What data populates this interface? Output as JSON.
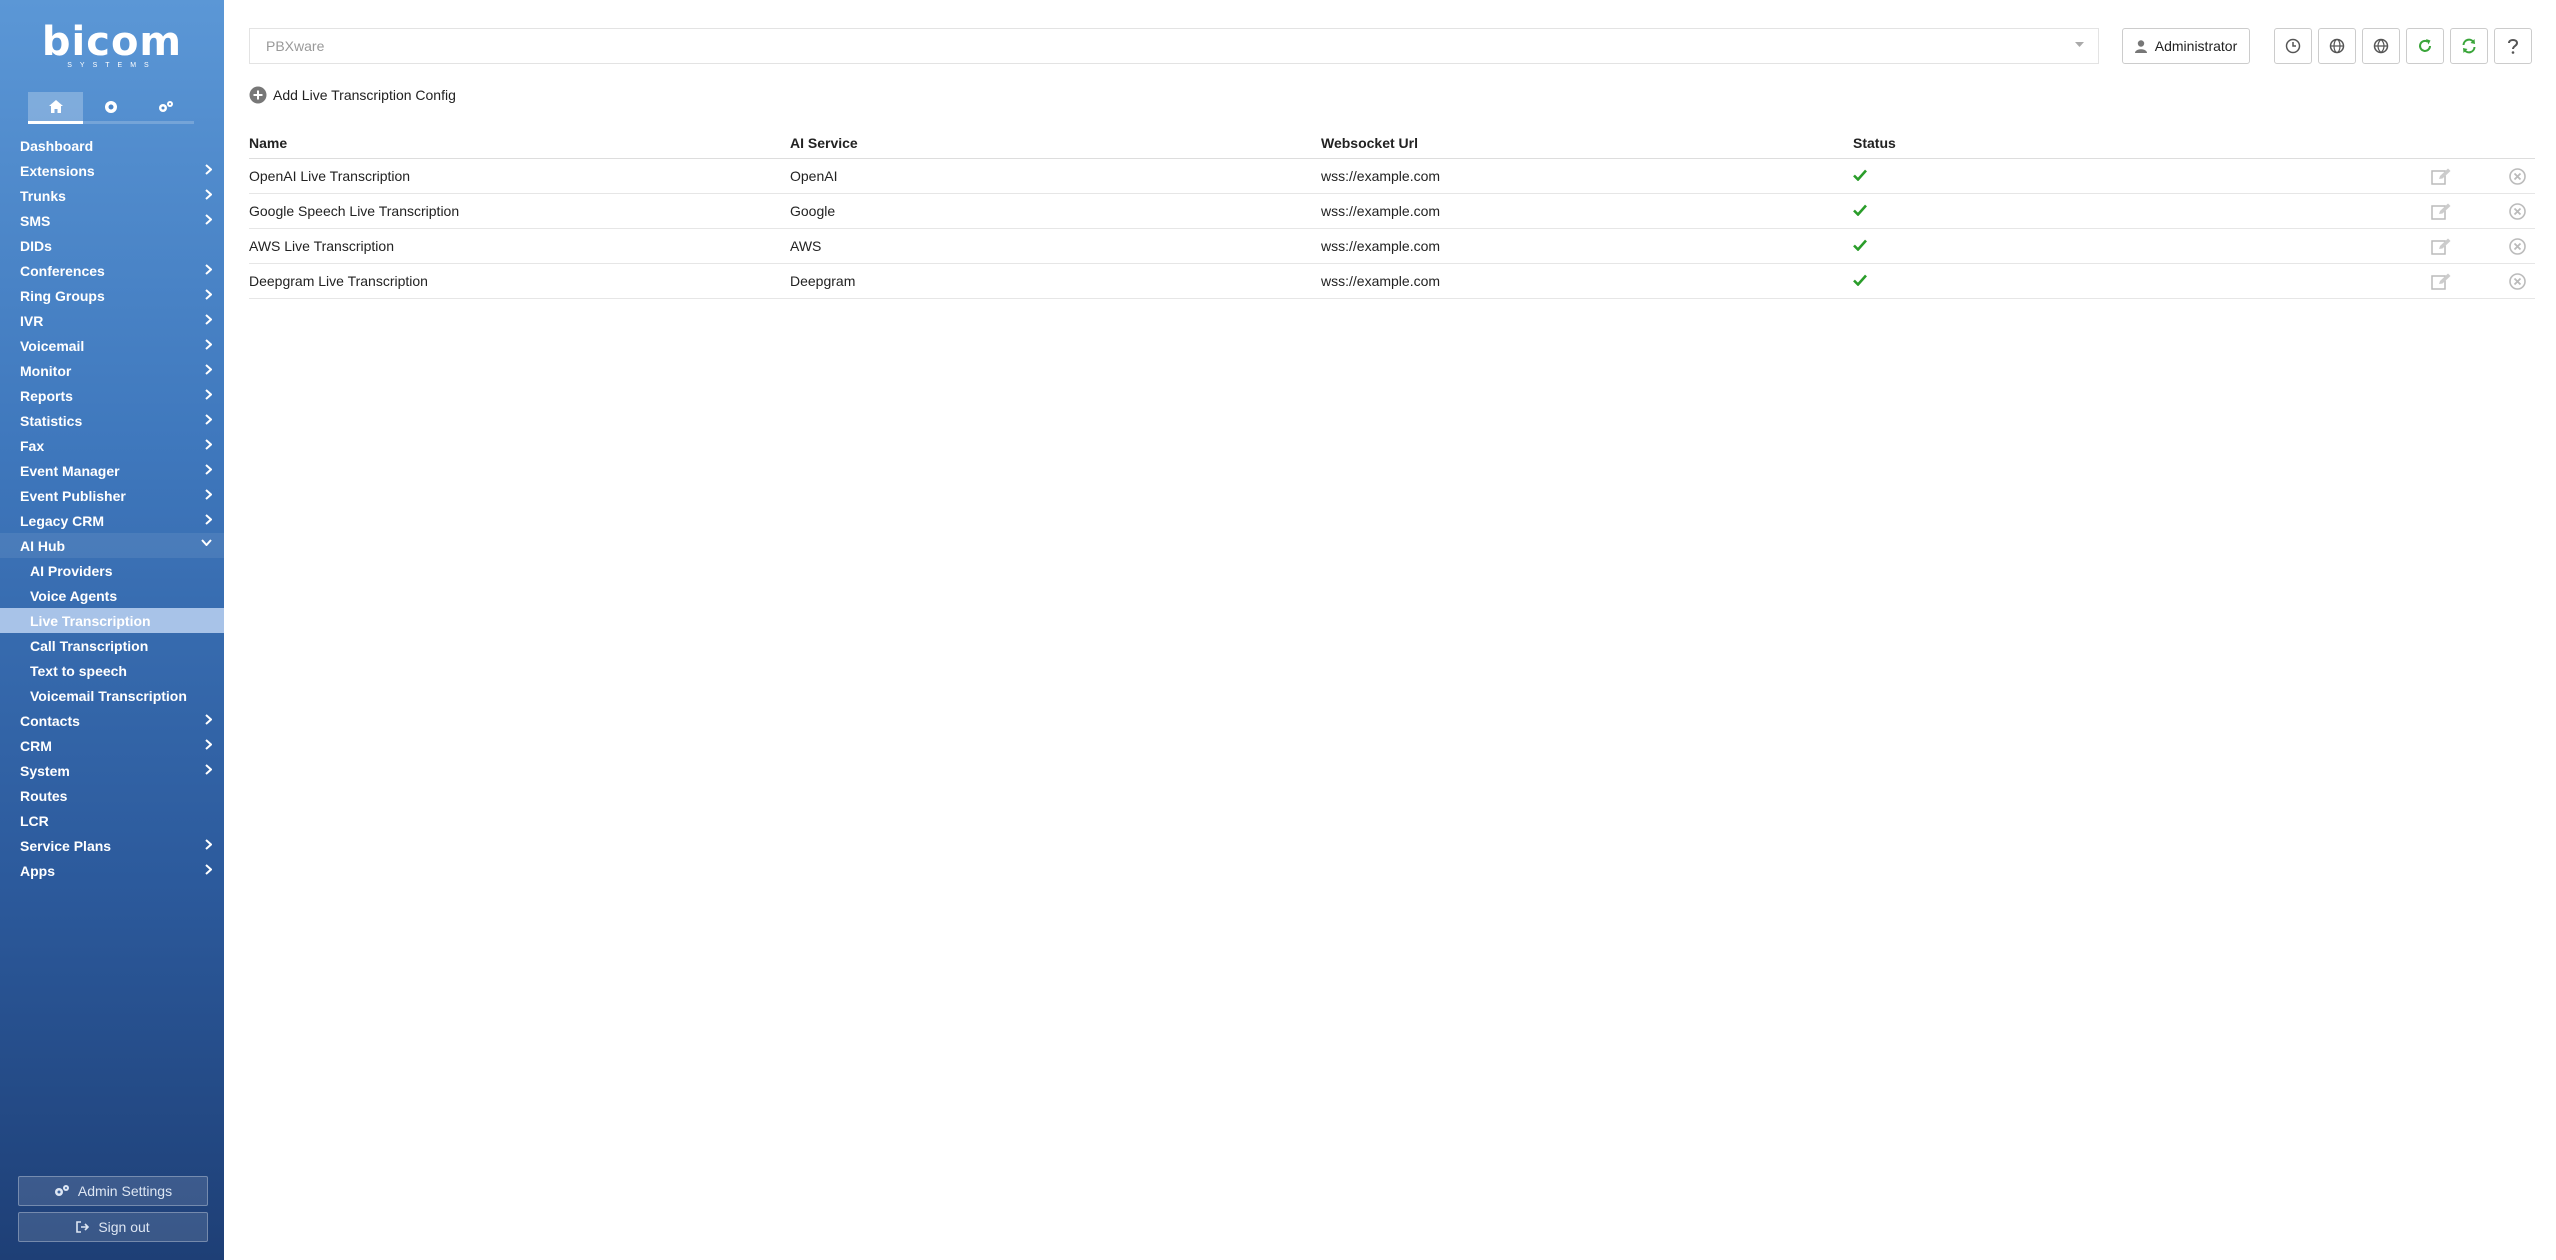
{
  "brand": {
    "logo_text": "bicom",
    "logo_sub": "SYSTEMS"
  },
  "sidebar": {
    "menu": [
      {
        "label": "Dashboard",
        "arrow": false
      },
      {
        "label": "Extensions",
        "arrow": true
      },
      {
        "label": "Trunks",
        "arrow": true
      },
      {
        "label": "SMS",
        "arrow": true
      },
      {
        "label": "DIDs",
        "arrow": false
      },
      {
        "label": "Conferences",
        "arrow": true
      },
      {
        "label": "Ring Groups",
        "arrow": true
      },
      {
        "label": "IVR",
        "arrow": true
      },
      {
        "label": "Voicemail",
        "arrow": true
      },
      {
        "label": "Monitor",
        "arrow": true
      },
      {
        "label": "Reports",
        "arrow": true
      },
      {
        "label": "Statistics",
        "arrow": true
      },
      {
        "label": "Fax",
        "arrow": true
      },
      {
        "label": "Event Manager",
        "arrow": true
      },
      {
        "label": "Event Publisher",
        "arrow": true
      },
      {
        "label": "Legacy CRM",
        "arrow": true
      },
      {
        "label": "AI Hub",
        "arrow": true,
        "open": true,
        "children": [
          {
            "label": "AI Providers"
          },
          {
            "label": "Voice Agents"
          },
          {
            "label": "Live Transcription",
            "active": true
          },
          {
            "label": "Call Transcription"
          },
          {
            "label": "Text to speech"
          },
          {
            "label": "Voicemail Transcription"
          }
        ]
      },
      {
        "label": "Contacts",
        "arrow": true
      },
      {
        "label": "CRM",
        "arrow": true
      },
      {
        "label": "System",
        "arrow": true
      },
      {
        "label": "Routes",
        "arrow": false
      },
      {
        "label": "LCR",
        "arrow": false
      },
      {
        "label": "Service Plans",
        "arrow": true
      },
      {
        "label": "Apps",
        "arrow": true
      }
    ],
    "admin_settings_label": "Admin Settings",
    "sign_out_label": "Sign out"
  },
  "topbar": {
    "server_select": {
      "value": "PBXware"
    },
    "user_label": "Administrator"
  },
  "main": {
    "add_label": "Add Live Transcription Config",
    "table": {
      "headers": [
        "Name",
        "AI Service",
        "Websocket Url",
        "Status"
      ],
      "rows": [
        {
          "name": "OpenAI Live Transcription",
          "service": "OpenAI",
          "url": "wss://example.com"
        },
        {
          "name": "Google Speech Live Transcription",
          "service": "Google",
          "url": "wss://example.com"
        },
        {
          "name": "AWS Live Transcription",
          "service": "AWS",
          "url": "wss://example.com"
        },
        {
          "name": "Deepgram Live Transcription",
          "service": "Deepgram",
          "url": "wss://example.com"
        }
      ]
    }
  },
  "colors": {
    "status_ok": "#2a9d2a",
    "refresh_green": "#3aa53a",
    "sidebar_active": "#a8c3e8"
  }
}
